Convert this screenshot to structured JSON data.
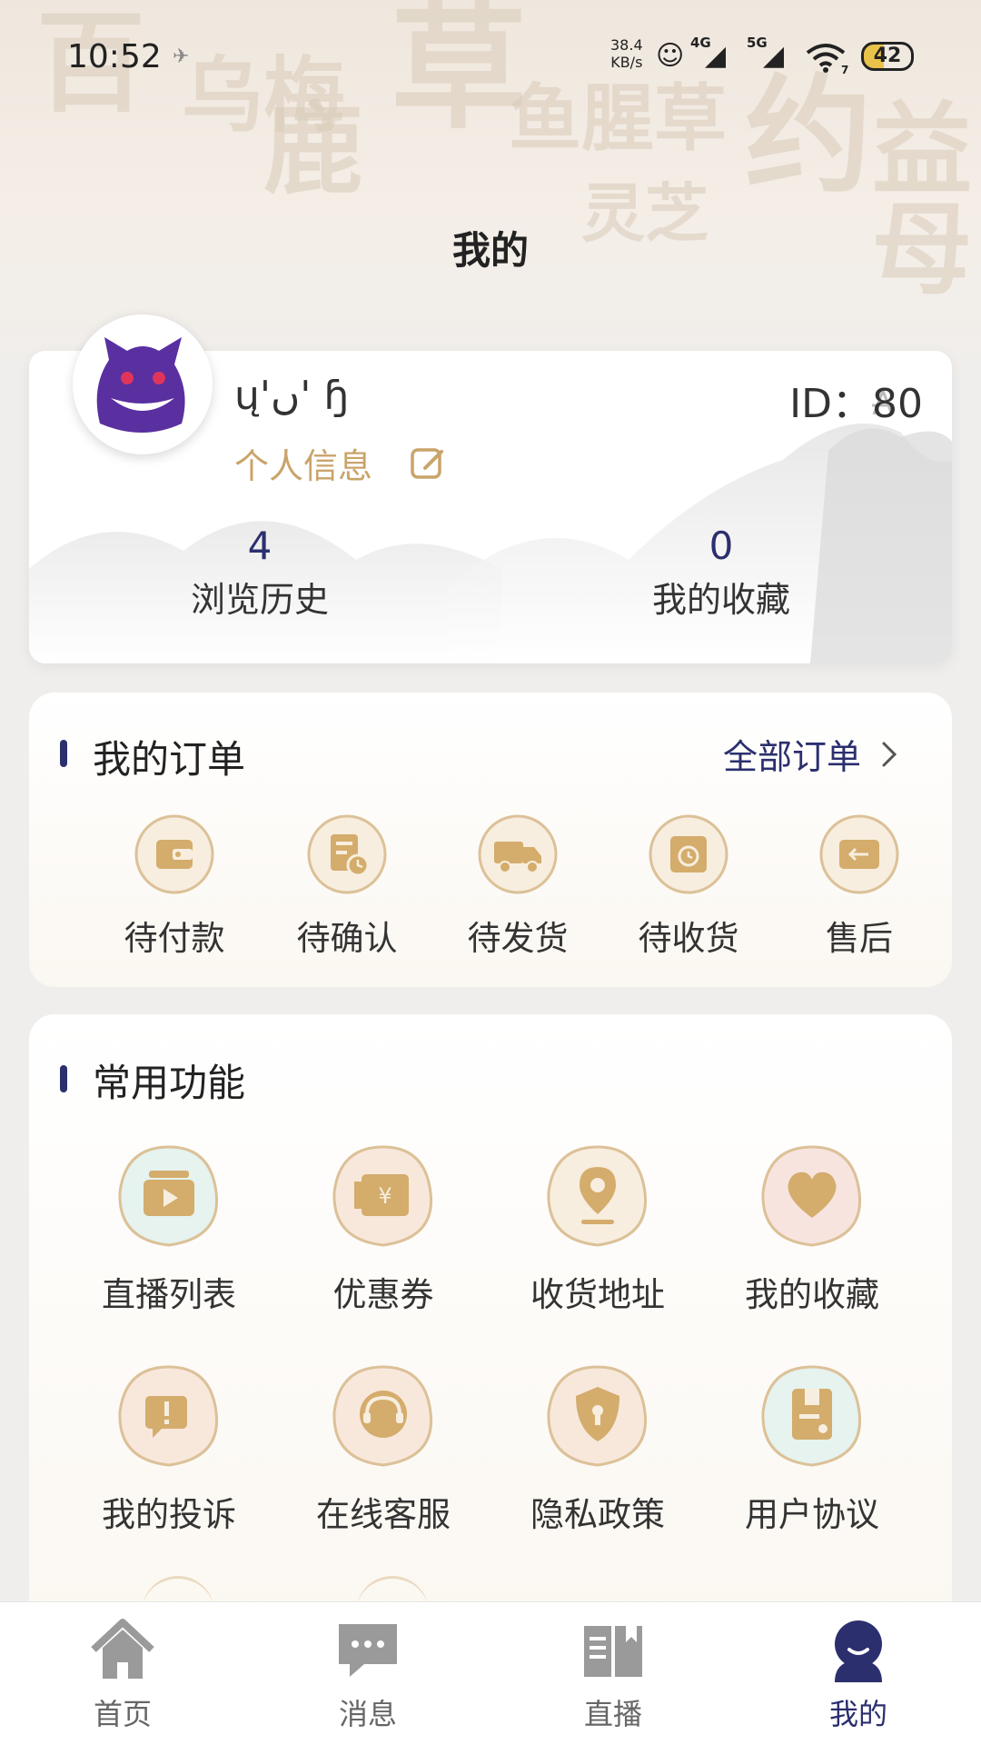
{
  "status_bar": {
    "time": "10:52",
    "speed_value": "38.4",
    "speed_unit": "KB/s",
    "net_4g": "4G",
    "net_5g": "5G",
    "wifi_sub": "7",
    "battery": "42"
  },
  "page_title": "我的",
  "profile": {
    "username": "ų'ں' ɧ",
    "id_text": "ID：80",
    "info_label": "个人信息",
    "stats": [
      {
        "value": "4",
        "label": "浏览历史"
      },
      {
        "value": "0",
        "label": "我的收藏"
      }
    ]
  },
  "orders": {
    "title": "我的订单",
    "all_label": "全部订单",
    "items": [
      {
        "label": "待付款",
        "icon": "wallet-icon"
      },
      {
        "label": "待确认",
        "icon": "document-clock-icon"
      },
      {
        "label": "待发货",
        "icon": "truck-icon"
      },
      {
        "label": "待收货",
        "icon": "box-clock-icon"
      },
      {
        "label": "售后",
        "icon": "return-icon"
      }
    ]
  },
  "functions": {
    "title": "常用功能",
    "items": [
      {
        "label": "直播列表",
        "icon": "video-camera-icon"
      },
      {
        "label": "优惠券",
        "icon": "coupon-icon"
      },
      {
        "label": "收货地址",
        "icon": "location-pin-icon"
      },
      {
        "label": "我的收藏",
        "icon": "heart-icon"
      },
      {
        "label": "我的投诉",
        "icon": "complaint-icon"
      },
      {
        "label": "在线客服",
        "icon": "headset-icon"
      },
      {
        "label": "隐私政策",
        "icon": "shield-lock-icon"
      },
      {
        "label": "用户协议",
        "icon": "agreement-icon"
      }
    ]
  },
  "tabbar": {
    "items": [
      {
        "label": "首页",
        "icon": "home-icon"
      },
      {
        "label": "消息",
        "icon": "message-icon"
      },
      {
        "label": "直播",
        "icon": "book-icon"
      },
      {
        "label": "我的",
        "icon": "profile-icon"
      }
    ],
    "active_index": 3
  },
  "colors": {
    "accent": "#2b2f6e",
    "gold": "#c9a46a",
    "avatar_purple": "#5a2fa0"
  }
}
